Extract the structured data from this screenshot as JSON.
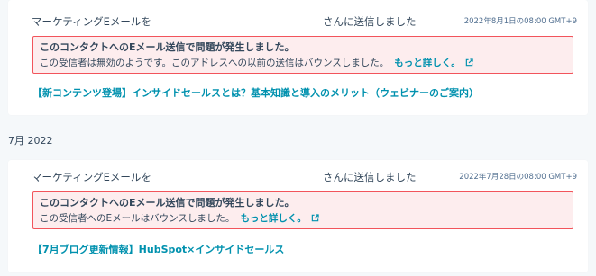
{
  "activities": [
    {
      "subject": "マーケティングEメールを",
      "recipient_text": "さんに送信しました",
      "timestamp": "2022年8月1日の08:00 GMT+9",
      "alert": {
        "title": "このコンタクトへのEメール送信で問題が発生しました。",
        "message": "この受信者は無効のようです。このアドレスへの以前の送信はバウンスしました。",
        "link_label": "もっと詳しく。",
        "link_icon": "external-link-icon"
      },
      "email_title": "【新コンテンツ登場】インサイドセールスとは？基本知識と導入のメリット（ウェビナーのご案内）"
    },
    {
      "subject": "マーケティングEメールを",
      "recipient_text": "さんに送信しました",
      "timestamp": "2022年7月28日の08:00 GMT+9",
      "alert": {
        "title": "このコンタクトへのEメール送信で問題が発生しました。",
        "message": "この受信者へのEメールはバウンスしました。",
        "link_label": "もっと詳しく。",
        "link_icon": "external-link-icon"
      },
      "email_title": "【7月ブログ更新情報】HubSpot×インサイドセールス"
    }
  ],
  "month_divider": "7月 2022",
  "colors": {
    "background": "#f5f8fa",
    "card": "#ffffff",
    "text": "#33475b",
    "link": "#0091ae",
    "alert_bg": "#fdedee",
    "alert_border": "#f2545b",
    "timestamp": "#516f90"
  }
}
